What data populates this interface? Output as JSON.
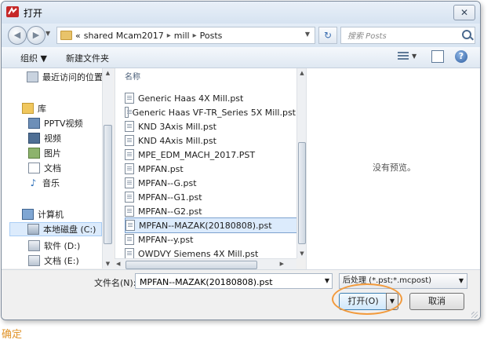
{
  "window": {
    "title": "打开",
    "close_glyph": "✕"
  },
  "nav_buttons": {
    "back_glyph": "◀",
    "forward_glyph": "▶"
  },
  "address": {
    "prefix": "«",
    "crumbs": [
      "shared Mcam2017",
      "mill",
      "Posts"
    ],
    "separator": "▸"
  },
  "search": {
    "placeholder": "搜索 Posts"
  },
  "toolbar": {
    "organize_label": "组织 ▼",
    "new_folder_label": "新建文件夹",
    "help_glyph": "?"
  },
  "navpane": {
    "items": [
      {
        "label": "最近访问的位置",
        "icon": "recent-places-icon"
      },
      {
        "label": "库",
        "icon": "library-icon"
      },
      {
        "label": "PPTV视频",
        "icon": "video-library-icon"
      },
      {
        "label": "视频",
        "icon": "video-icon"
      },
      {
        "label": "图片",
        "icon": "pictures-icon"
      },
      {
        "label": "文档",
        "icon": "documents-icon"
      },
      {
        "label": "音乐",
        "icon": "music-icon"
      },
      {
        "label": "计算机",
        "icon": "computer-icon"
      },
      {
        "label": "本地磁盘 (C:)",
        "icon": "local-disk-icon"
      },
      {
        "label": "软件 (D:)",
        "icon": "drive-icon"
      },
      {
        "label": "文档 (E:)",
        "icon": "drive-icon"
      }
    ]
  },
  "filelist": {
    "column_name": "名称",
    "files": [
      "Generic Haas 4X Mill.pst",
      "Generic Haas VF-TR_Series 5X Mill.pst",
      "KND 3Axis Mill.pst",
      "KND 4Axis Mill.pst",
      "MPE_EDM_MACH_2017.PST",
      "MPFAN.pst",
      "MPFAN--G.pst",
      "MPFAN--G1.pst",
      "MPFAN--G2.pst",
      "MPFAN--MAZAK(20180808).pst",
      "MPFAN--y.pst",
      "OWDVY Siemens 4X Mill.pst"
    ],
    "selected_index": 9
  },
  "preview": {
    "text": "没有预览。"
  },
  "bottom": {
    "filename_label": "文件名(N):",
    "filename_value": "MPFAN--MAZAK(20180808).pst",
    "filter_label": "后处理 (*.pst;*.mcpost)",
    "open_label": "打开(O)",
    "cancel_label": "取消"
  },
  "caption": "确定",
  "colors": {
    "highlight": "#f29a3c",
    "caption": "#e0942b",
    "selection": "#dcebfc"
  }
}
